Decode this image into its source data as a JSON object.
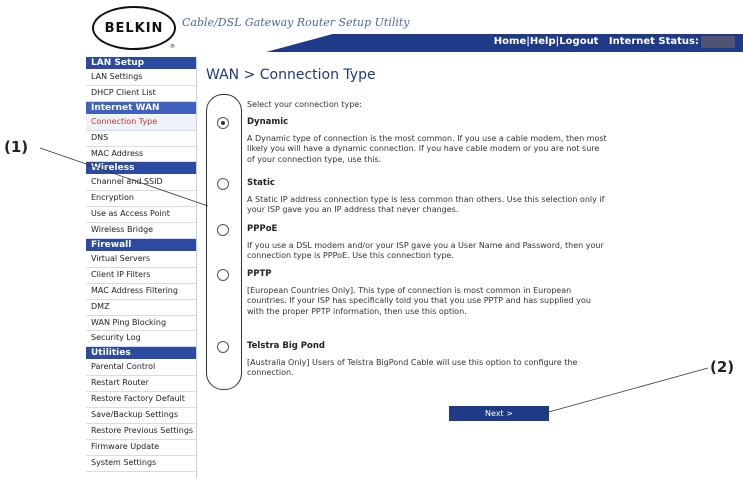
{
  "header": {
    "logo_text": "BELKIN",
    "registered_mark": "®",
    "utility_title": "Cable/DSL Gateway Router Setup Utility",
    "links": [
      "Home",
      "Help",
      "Logout"
    ],
    "link_separator": "|",
    "internet_status_label": "Internet Status:"
  },
  "sidebar": {
    "sections": [
      {
        "title": "LAN Setup",
        "items": [
          "LAN Settings",
          "DHCP Client List"
        ]
      },
      {
        "title": "Internet WAN",
        "items": [
          "Connection Type",
          "DNS",
          "MAC Address"
        ]
      },
      {
        "title": "Wireless",
        "items": [
          "Channel and SSID",
          "Encryption",
          "Use as Access Point",
          "Wireless Bridge"
        ]
      },
      {
        "title": "Firewall",
        "items": [
          "Virtual Servers",
          "Client IP Filters",
          "MAC Address Filtering",
          "DMZ",
          "WAN Ping Blocking",
          "Security Log"
        ]
      },
      {
        "title": "Utilities",
        "items": [
          "Parental Control",
          "Restart Router",
          "Restore Factory Default",
          "Save/Backup Settings",
          "Restore Previous Settings",
          "Firmware Update",
          "System Settings"
        ]
      }
    ],
    "active_item": "Connection Type"
  },
  "main": {
    "title": "WAN > Connection Type",
    "prompt": "Select your connection type:",
    "selected": "Dynamic",
    "options": [
      {
        "title": "Dynamic",
        "desc": "A Dynamic type of connection is the most common. If you use a cable modem, then most likely you will have a dynamic connection. If you have cable modem or you are not sure of your connection type, use this."
      },
      {
        "title": "Static",
        "desc": "A Static IP address connection type is less common than others. Use this selection only if your ISP gave you an IP address that never changes."
      },
      {
        "title": "PPPoE",
        "desc": "If you use a DSL modem and/or your ISP gave you a User Name and Password, then your connection type is PPPoE. Use this connection type."
      },
      {
        "title": "PPTP",
        "desc": "[European Countries Only]. This type of connection is most common in European countries. If your ISP has specifically told you that you use PPTP and has supplied you with the proper PPTP information, then use this option."
      },
      {
        "title": "Telstra Big Pond",
        "desc": "[Australia Only] Users of Telstra BigPond Cable will use this option to configure the connection."
      }
    ],
    "next_label": "Next >"
  },
  "callouts": {
    "one": "(1)",
    "two": "(2)"
  },
  "colors": {
    "nav_blue": "#1f3a86",
    "section_blue": "#2c4aa0",
    "active_red": "#c0392b"
  }
}
